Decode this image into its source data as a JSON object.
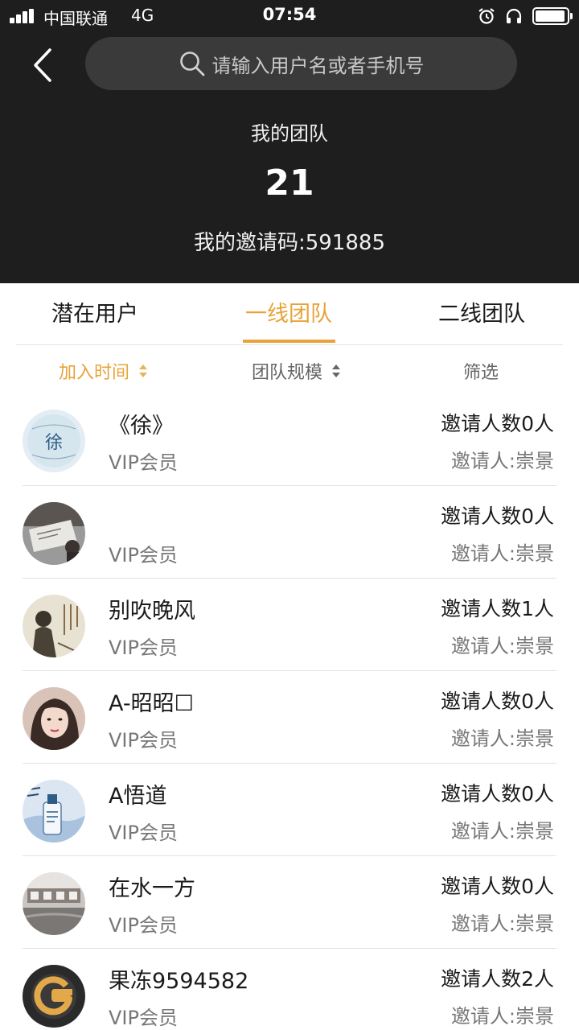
{
  "status_bar": {
    "carrier": "中国联通",
    "network": "4G",
    "time": "07:54"
  },
  "search": {
    "placeholder": "请输入用户名或者手机号"
  },
  "header": {
    "title": "我的团队",
    "count": "21",
    "invite_code": "我的邀请码:591885"
  },
  "tabs": [
    {
      "label": "潜在用户",
      "active": false
    },
    {
      "label": "一线团队",
      "active": true
    },
    {
      "label": "二线团队",
      "active": false
    }
  ],
  "filters": {
    "join_time": "加入时间",
    "team_size": "团队规模",
    "screen": "筛选"
  },
  "colors": {
    "accent": "#e8a33a",
    "header_bg": "#1e1e1e"
  },
  "members": [
    {
      "name": "《徐》",
      "level": "VIP会员",
      "invites": "邀请人数0人",
      "inviter": "邀请人:崇景",
      "avatar": "xu-avatar"
    },
    {
      "name": "",
      "level": "VIP会员",
      "invites": "邀请人数0人",
      "inviter": "邀请人:崇景",
      "avatar": "photo-avatar"
    },
    {
      "name": "别吹晚风",
      "level": "VIP会员",
      "invites": "邀请人数1人",
      "inviter": "邀请人:崇景",
      "avatar": "painting-avatar"
    },
    {
      "name": "A-昭昭☐",
      "level": "VIP会员",
      "invites": "邀请人数0人",
      "inviter": "邀请人:崇景",
      "avatar": "portrait-avatar"
    },
    {
      "name": "A悟道",
      "level": "VIP会员",
      "invites": "邀请人数0人",
      "inviter": "邀请人:崇景",
      "avatar": "bottle-avatar"
    },
    {
      "name": "在水一方",
      "level": "VIP会员",
      "invites": "邀请人数0人",
      "inviter": "邀请人:崇景",
      "avatar": "building-avatar"
    },
    {
      "name": "果冻9594582",
      "level": "VIP会员",
      "invites": "邀请人数2人",
      "inviter": "邀请人:崇景",
      "avatar": "g-logo-avatar"
    }
  ]
}
